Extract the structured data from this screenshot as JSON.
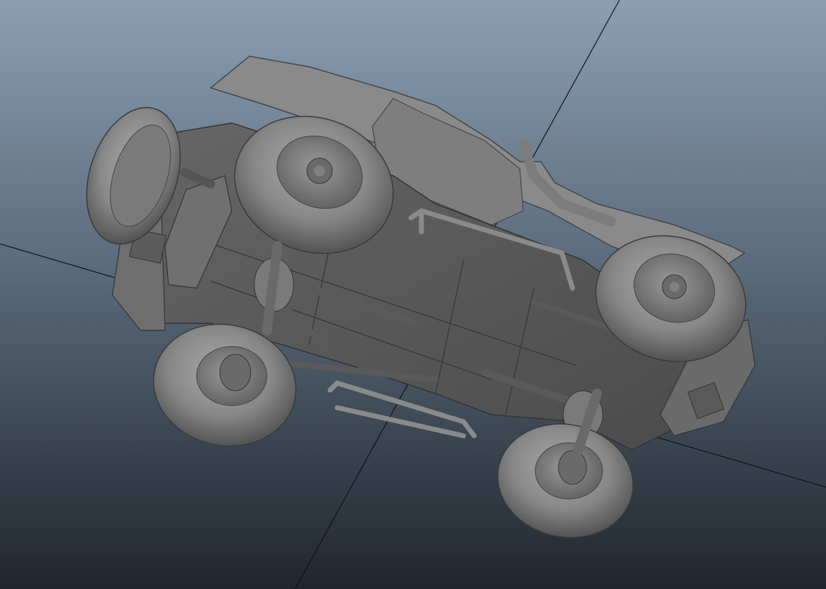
{
  "viewport": {
    "background_top": "#8a9db2",
    "background_bottom": "#232a32",
    "model_color": "#7a7a7a"
  },
  "model": {
    "name": "jeep-underside-view"
  }
}
